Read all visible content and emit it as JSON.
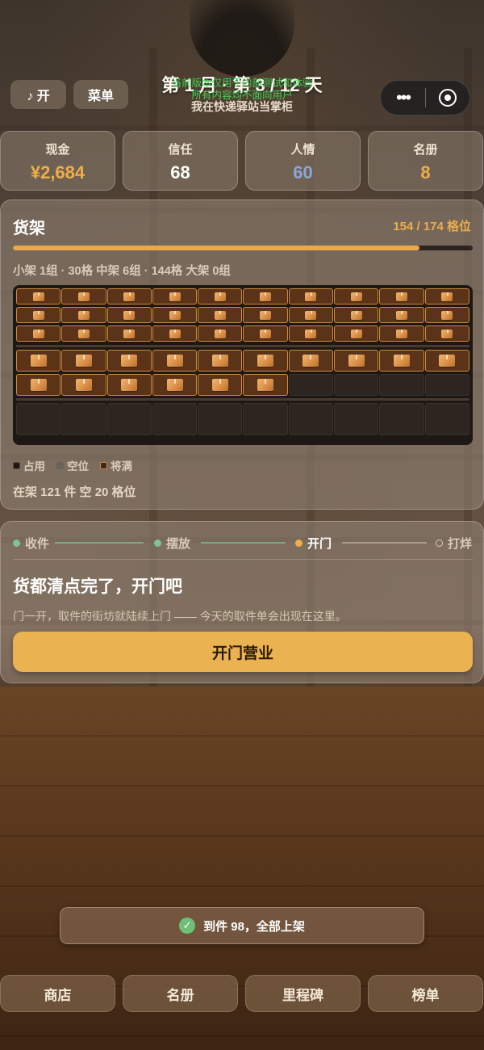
{
  "header": {
    "music_label": "♪ 开",
    "menu_label": "菜单",
    "title": "第 1 月 · 第 3 / 12 天",
    "subtitle": "我在快递驿站当掌柜",
    "watermark_line1": "当前版本仅用于内部测试和体验",
    "watermark_line2": "所有内容均不面向用户",
    "capsule_more_icon": "more-dots-icon",
    "capsule_close_icon": "target-ring-icon"
  },
  "stats": [
    {
      "label": "现金",
      "value": "¥2,684",
      "color": "#eeae4a"
    },
    {
      "label": "信任",
      "value": "68",
      "color": "#ffffff"
    },
    {
      "label": "人情",
      "value": "60",
      "color": "#8aa6d6"
    },
    {
      "label": "名册",
      "value": "8",
      "color": "#eeae4a"
    }
  ],
  "shelf": {
    "title": "货架",
    "capacity": "154 / 174 格位",
    "fill_ratio": 0.885,
    "summary": "小架 1组 · 30格  中架 6组 · 144格  大架 0组",
    "small_rows": [
      10,
      10,
      10
    ],
    "mid_rows": [
      10,
      6,
      0
    ],
    "columns": 10,
    "legend": [
      {
        "label": "占用",
        "color": "#1d1815"
      },
      {
        "label": "空位",
        "color": "#6b625a"
      },
      {
        "label": "将满",
        "color": "#d08a3c"
      }
    ],
    "stock_line": "在架 121 件   空 20 格位"
  },
  "steps": [
    {
      "label": "收件",
      "state": "done",
      "color": "#7ec39a"
    },
    {
      "label": "摆放",
      "state": "done",
      "color": "#7ec39a"
    },
    {
      "label": "开门",
      "state": "current",
      "color": "#eeae4a"
    },
    {
      "label": "打烊",
      "state": "todo",
      "color": "#d8ccb8"
    }
  ],
  "open_panel": {
    "title": "货都清点完了，开门吧",
    "description": "门一开，取件的街坊就陆续上门 —— 今天的取件单会出现在这里。",
    "button_label": "开门营业"
  },
  "toast": {
    "icon": "check-circle-icon",
    "text": "到件 98，全部上架"
  },
  "nav": [
    "商店",
    "名册",
    "里程碑",
    "榜单"
  ]
}
